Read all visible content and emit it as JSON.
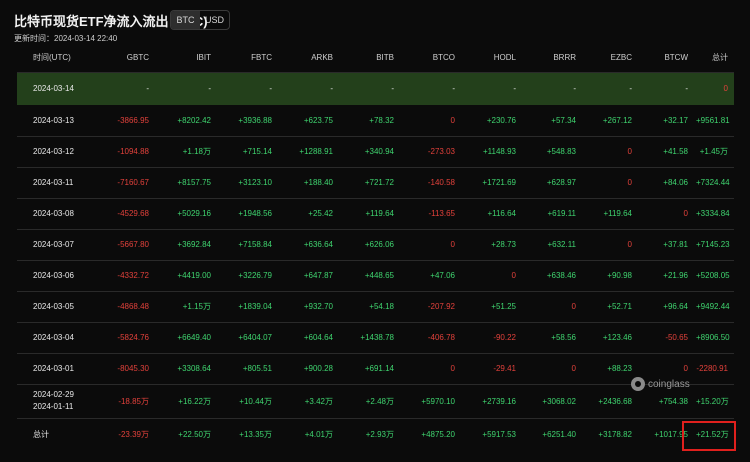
{
  "header": {
    "title": "比特币现货ETF净流入流出 (BTC)",
    "toggle": [
      "BTC",
      "USD"
    ],
    "active": "BTC",
    "updated": "更新时间：2024-03-14 22:40"
  },
  "table": {
    "columns": [
      "时间(UTC)",
      "GBTC",
      "IBIT",
      "FBTC",
      "ARKB",
      "BITB",
      "BTCO",
      "HODL",
      "BRRR",
      "EZBC",
      "BTCW",
      "总计"
    ],
    "rows": [
      {
        "date": "2024-03-14",
        "vals": [
          "-",
          "-",
          "-",
          "-",
          "-",
          "-",
          "-",
          "-",
          "-",
          "-",
          "0"
        ]
      },
      {
        "date": "2024-03-13",
        "vals": [
          "-3866.95",
          "+8202.42",
          "+3936.88",
          "+623.75",
          "+78.32",
          "0",
          "+230.76",
          "+57.34",
          "+267.12",
          "+32.17",
          "+9561.81"
        ]
      },
      {
        "date": "2024-03-12",
        "vals": [
          "-1094.88",
          "+1.18万",
          "+715.14",
          "+1288.91",
          "+340.94",
          "-273.03",
          "+1148.93",
          "+548.83",
          "0",
          "+41.58",
          "+1.45万"
        ]
      },
      {
        "date": "2024-03-11",
        "vals": [
          "-7160.67",
          "+8157.75",
          "+3123.10",
          "+188.40",
          "+721.72",
          "-140.58",
          "+1721.69",
          "+628.97",
          "0",
          "+84.06",
          "+7324.44"
        ]
      },
      {
        "date": "2024-03-08",
        "vals": [
          "-4529.68",
          "+5029.16",
          "+1948.56",
          "+25.42",
          "+119.64",
          "-113.65",
          "+116.64",
          "+619.11",
          "+119.64",
          "0",
          "+3334.84"
        ]
      },
      {
        "date": "2024-03-07",
        "vals": [
          "-5667.80",
          "+3692.84",
          "+7158.84",
          "+636.64",
          "+626.06",
          "0",
          "+28.73",
          "+632.11",
          "0",
          "+37.81",
          "+7145.23"
        ]
      },
      {
        "date": "2024-03-06",
        "vals": [
          "-4332.72",
          "+4419.00",
          "+3226.79",
          "+647.87",
          "+448.65",
          "+47.06",
          "0",
          "+638.46",
          "+90.98",
          "+21.96",
          "+5208.05"
        ]
      },
      {
        "date": "2024-03-05",
        "vals": [
          "-4868.48",
          "+1.15万",
          "+1839.04",
          "+932.70",
          "+54.18",
          "-207.92",
          "+51.25",
          "0",
          "+52.71",
          "+96.64",
          "+9492.44"
        ]
      },
      {
        "date": "2024-03-04",
        "vals": [
          "-5824.76",
          "+6649.40",
          "+6404.07",
          "+604.64",
          "+1438.78",
          "-406.78",
          "-90.22",
          "+58.56",
          "+123.46",
          "-50.65",
          "+8906.50"
        ]
      },
      {
        "date": "2024-03-01",
        "vals": [
          "-8045.30",
          "+3308.64",
          "+805.51",
          "+900.28",
          "+691.14",
          "0",
          "-29.41",
          "0",
          "+88.23",
          "0",
          "-2280.91"
        ]
      },
      {
        "date": "2024-02-29",
        "date2": "2024-01-11",
        "vals": [
          "-18.85万",
          "+16.22万",
          "+10.44万",
          "+3.42万",
          "+2.48万",
          "+5970.10",
          "+2739.16",
          "+3068.02",
          "+2436.68",
          "+754.38",
          "+15.20万"
        ]
      },
      {
        "date": "总计",
        "vals": [
          "-23.39万",
          "+22.50万",
          "+13.35万",
          "+4.01万",
          "+2.93万",
          "+4875.20",
          "+5917.53",
          "+6251.40",
          "+3178.82",
          "+1017.95",
          "+21.52万"
        ]
      }
    ]
  },
  "watermark": "coinglass",
  "colors": {
    "positive": "#3fd46f",
    "negative": "#e2413b",
    "highlight_row": "#23401b",
    "annotation_box": "#e0201d"
  }
}
